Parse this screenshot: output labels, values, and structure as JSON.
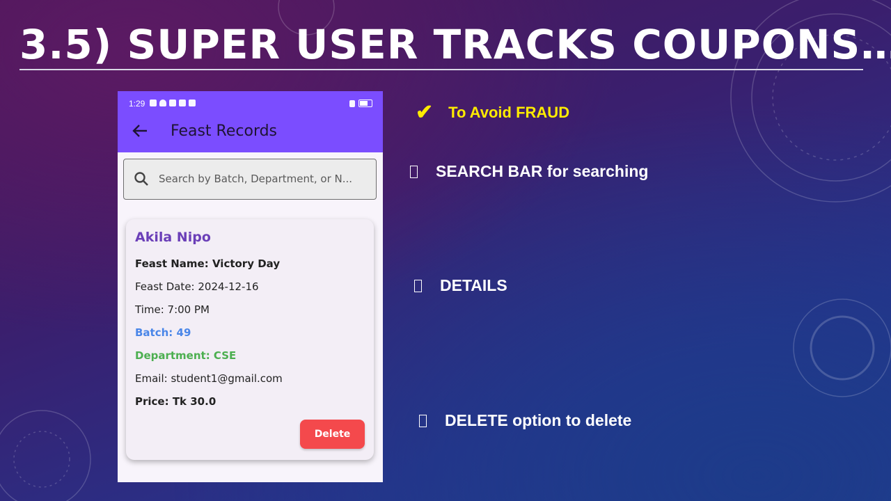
{
  "slide": {
    "title": "3.5) SUPER USER TRACKS COUPONS…"
  },
  "phone": {
    "status_time": "1:29",
    "appbar_title": "Feast Records",
    "search_placeholder": "Search by Batch, Department, or N...",
    "record": {
      "name": "Akila Nipo",
      "feast_name": "Feast Name: Victory Day",
      "feast_date": "Feast Date: 2024-12-16",
      "time": "Time: 7:00 PM",
      "batch": "Batch: 49",
      "department": "Department: CSE",
      "email": "Email: student1@gmail.com",
      "price": "Price: Tk 30.0",
      "delete_label": "Delete"
    }
  },
  "bullets": {
    "fraud": "To Avoid FRAUD",
    "search": "SEARCH BAR for searching",
    "details": "DETAILS",
    "delete": "DELETE option to delete"
  },
  "colors": {
    "appbar": "#7b4dff",
    "name": "#6b3fb8",
    "batch": "#4a86e8",
    "department": "#4caf50",
    "delete_button": "#f4494c",
    "accent_yellow": "#ffeb00"
  }
}
